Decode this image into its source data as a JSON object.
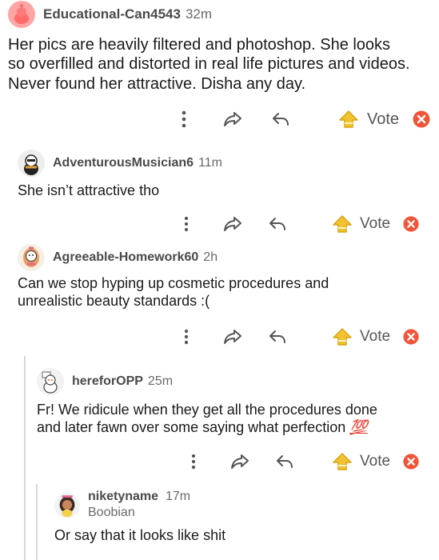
{
  "comments": [
    {
      "author": "Educational-Can4543",
      "age": "32m",
      "body_lines": [
        "Her pics are heavily filtered and photoshop.  She looks",
        "so overfilled and distorted in real life pictures and videos.",
        "Never found her attractive.  Disha any day."
      ],
      "vote_label": "Vote"
    },
    {
      "author": "AdventurousMusician6",
      "age": "11m",
      "body_lines": [
        "She isn’t attractive tho"
      ],
      "vote_label": "Vote"
    },
    {
      "author": "Agreeable-Homework60",
      "age": "2h",
      "body_lines": [
        "Can we stop hyping up cosmetic procedures and",
        "unrealistic beauty standards :("
      ],
      "vote_label": "Vote"
    },
    {
      "author": "hereforOPP",
      "age": "25m",
      "body_lines": [
        "Fr! We ridicule when they get all the procedures done",
        "and later fawn over some saying what perfection"
      ],
      "emoji": "💯",
      "vote_label": "Vote"
    },
    {
      "author": "niketyname",
      "age": "17m",
      "flair": "Boobian",
      "body_lines": [
        "Or say that it looks like shit"
      ]
    }
  ],
  "colors": {
    "upvote": "#f2c230",
    "downvote": "#f0553a",
    "icon_gray": "#555555",
    "thread_line": "#d8d8d8"
  },
  "icons": {
    "more": "more-vertical-icon",
    "share": "share-icon",
    "reply": "reply-icon",
    "upvote": "upvote-icon",
    "downvote": "downvote-icon"
  }
}
